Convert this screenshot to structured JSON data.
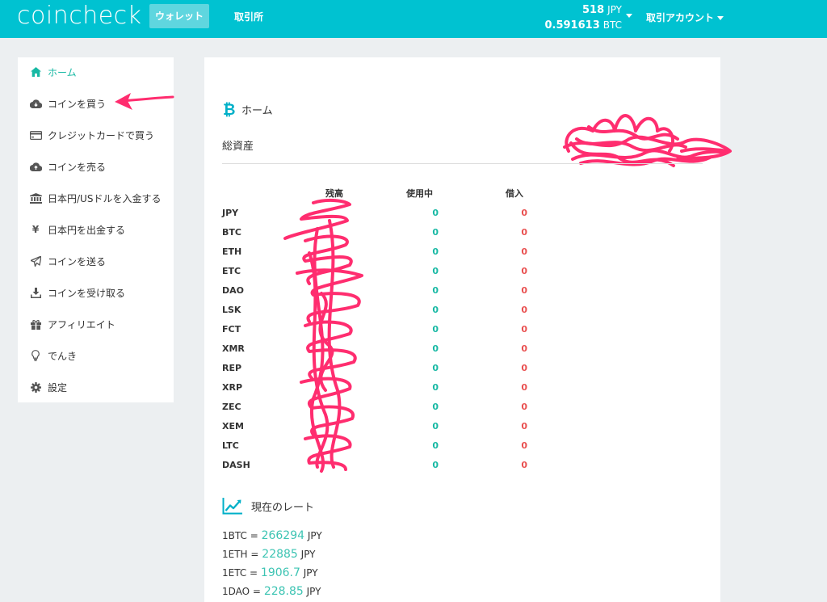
{
  "header": {
    "logo": "coincheck",
    "nav": {
      "wallet": "ウォレット",
      "exchange": "取引所"
    },
    "balance": {
      "jpy_value": "518",
      "jpy_unit": "JPY",
      "btc_value": "0.591613",
      "btc_unit": "BTC"
    },
    "account_label": "取引アカウント"
  },
  "sidebar": {
    "items": [
      {
        "label": "ホーム",
        "icon": "home-icon"
      },
      {
        "label": "コインを買う",
        "icon": "cloud-download-icon"
      },
      {
        "label": "クレジットカードで買う",
        "icon": "credit-card-icon"
      },
      {
        "label": "コインを売る",
        "icon": "cloud-upload-icon"
      },
      {
        "label": "日本円/USドルを入金する",
        "icon": "bank-icon"
      },
      {
        "label": "日本円を出金する",
        "icon": "yen-icon"
      },
      {
        "label": "コインを送る",
        "icon": "paper-plane-icon"
      },
      {
        "label": "コインを受け取る",
        "icon": "download-icon"
      },
      {
        "label": "アフィリエイト",
        "icon": "gift-icon"
      },
      {
        "label": "でんき",
        "icon": "lightbulb-icon"
      },
      {
        "label": "設定",
        "icon": "gear-icon"
      }
    ]
  },
  "main": {
    "title": "ホーム",
    "total_assets_label": "総資産",
    "table": {
      "headers": {
        "balance": "残高",
        "in_use": "使用中",
        "borrowed": "借入"
      },
      "rows": [
        {
          "coin": "JPY",
          "in_use": "0",
          "borrowed": "0"
        },
        {
          "coin": "BTC",
          "in_use": "0",
          "borrowed": "0"
        },
        {
          "coin": "ETH",
          "in_use": "0",
          "borrowed": "0"
        },
        {
          "coin": "ETC",
          "in_use": "0",
          "borrowed": "0"
        },
        {
          "coin": "DAO",
          "in_use": "0",
          "borrowed": "0"
        },
        {
          "coin": "LSK",
          "in_use": "0",
          "borrowed": "0"
        },
        {
          "coin": "FCT",
          "in_use": "0",
          "borrowed": "0"
        },
        {
          "coin": "XMR",
          "in_use": "0",
          "borrowed": "0"
        },
        {
          "coin": "REP",
          "in_use": "0",
          "borrowed": "0"
        },
        {
          "coin": "XRP",
          "in_use": "0",
          "borrowed": "0"
        },
        {
          "coin": "ZEC",
          "in_use": "0",
          "borrowed": "0"
        },
        {
          "coin": "XEM",
          "in_use": "0",
          "borrowed": "0"
        },
        {
          "coin": "LTC",
          "in_use": "0",
          "borrowed": "0"
        },
        {
          "coin": "DASH",
          "in_use": "0",
          "borrowed": "0"
        }
      ]
    },
    "rates_title": "現在のレート",
    "rates": [
      {
        "prefix": "1BTC =",
        "value": "266294",
        "unit": "JPY"
      },
      {
        "prefix": "1ETH =",
        "value": "22885",
        "unit": "JPY"
      },
      {
        "prefix": "1ETC =",
        "value": "1906.7",
        "unit": "JPY"
      },
      {
        "prefix": "1DAO =",
        "value": "228.85",
        "unit": "JPY"
      }
    ]
  },
  "colors": {
    "header_bg": "#00c2d1",
    "accent_green": "#18b9a4",
    "accent_red": "#e94f4f",
    "annotation_pink": "#ff2d6f"
  }
}
